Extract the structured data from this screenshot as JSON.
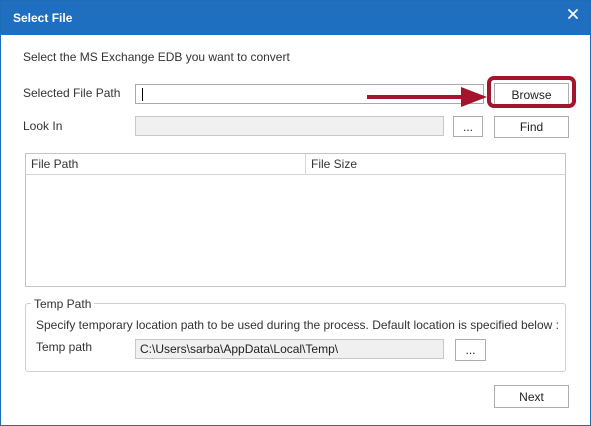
{
  "window": {
    "title": "Select File",
    "close_glyph": "✕"
  },
  "main": {
    "instruction": "Select the MS Exchange EDB you want to convert",
    "selected_file_path_label": "Selected File Path",
    "selected_file_path_value": "",
    "browse_label": "Browse",
    "look_in_label": "Look In",
    "look_in_value": "",
    "ellipsis_label": "...",
    "find_label": "Find"
  },
  "file_list": {
    "columns": [
      "File Path",
      "File Size"
    ],
    "rows": []
  },
  "temp_group": {
    "title": "Temp Path",
    "description": "Specify temporary location path to be used during the process. Default location is specified below :",
    "temp_path_label": "Temp path",
    "temp_path_value": "C:\\Users\\sarba\\AppData\\Local\\Temp\\",
    "ellipsis_label": "..."
  },
  "footer": {
    "next_label": "Next"
  },
  "colors": {
    "titlebar": "#1f6fc0",
    "annotation": "#a4142c"
  },
  "annotation": {
    "arrow_icon": "arrow-right-icon",
    "highlight_target": "browse-button"
  }
}
